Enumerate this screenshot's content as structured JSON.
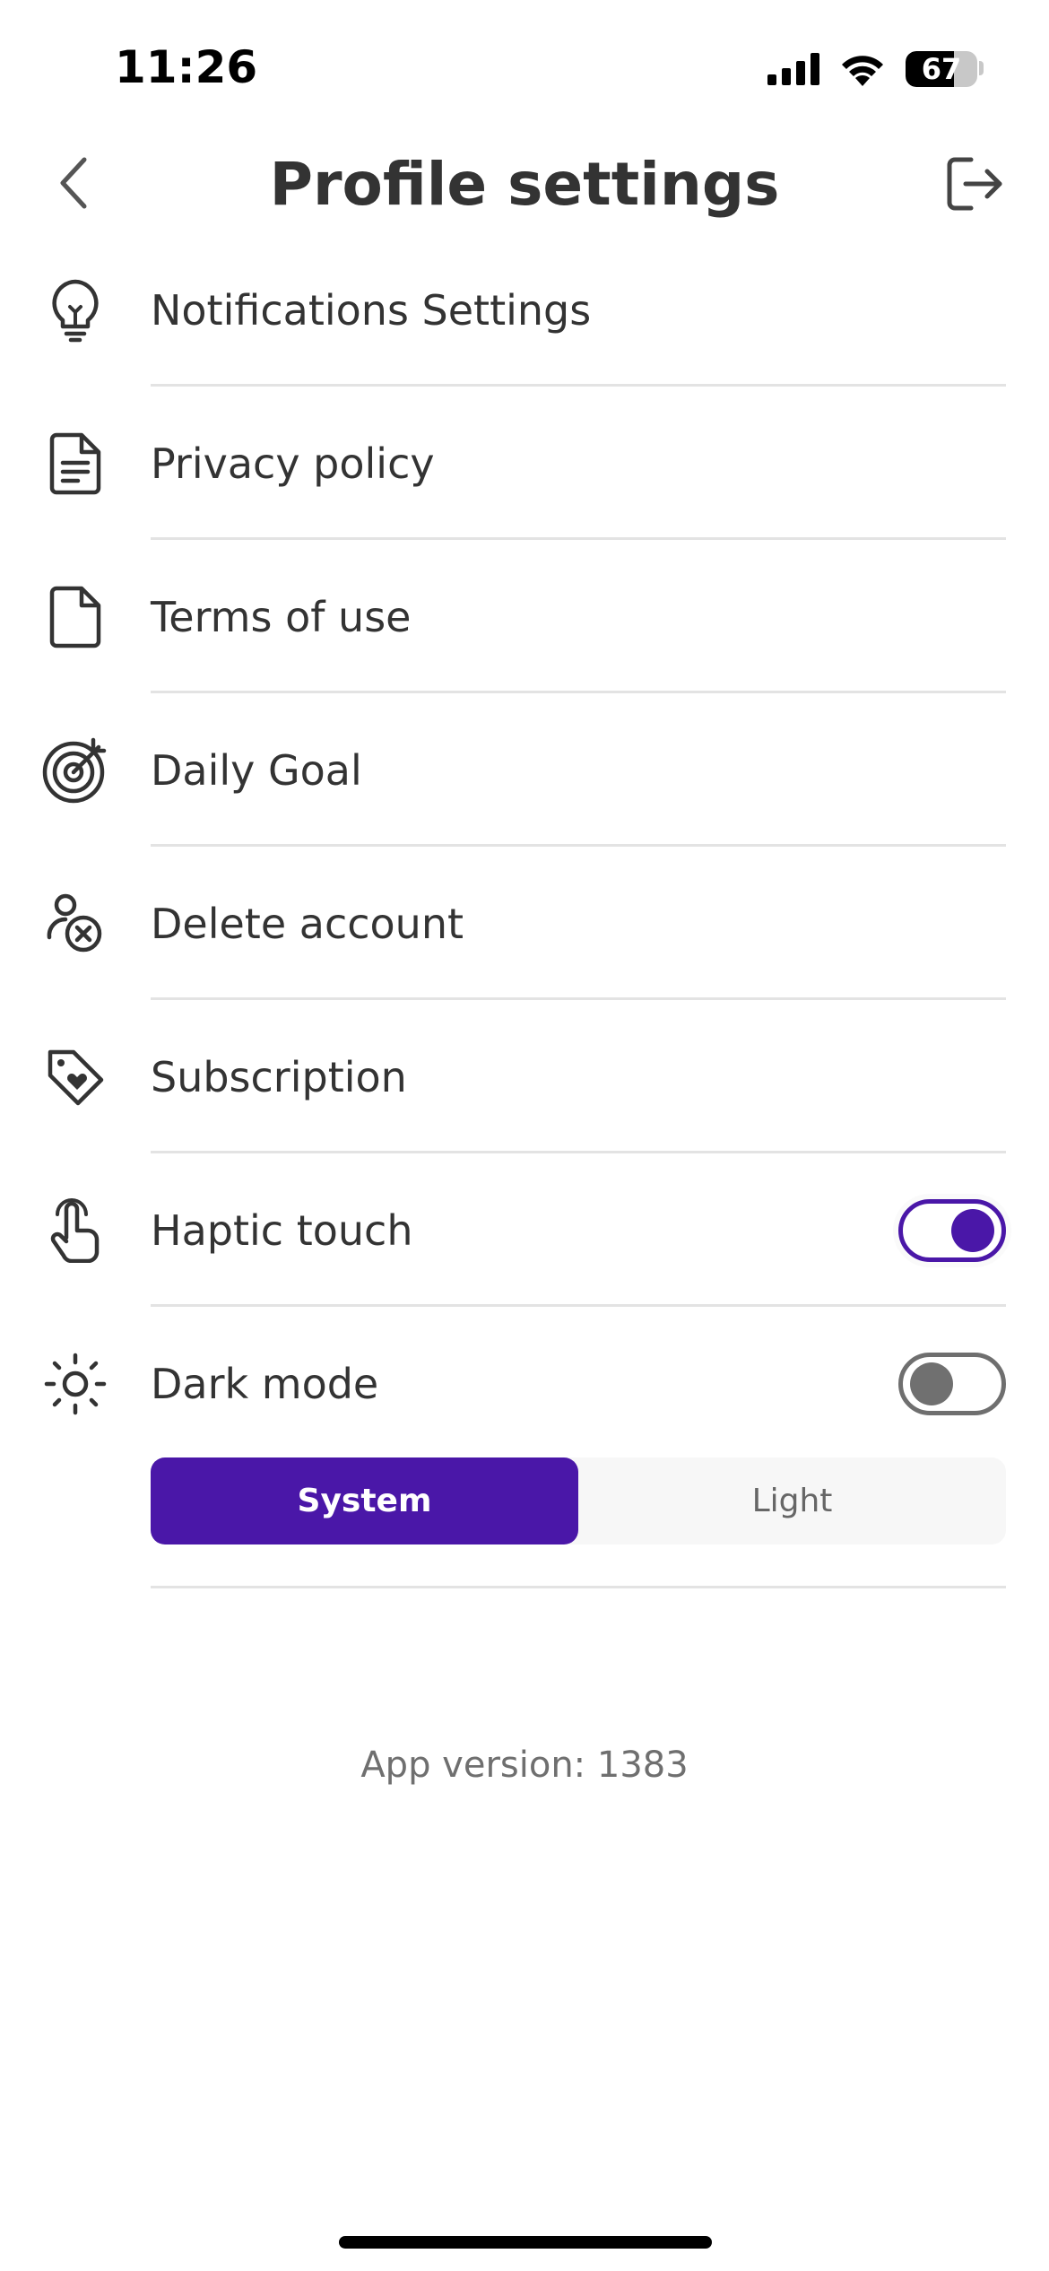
{
  "status_bar": {
    "time": "11:26",
    "battery_percent": 67,
    "battery_label": "67",
    "icons": [
      "cellular-signal-icon",
      "wifi-icon",
      "battery-icon"
    ]
  },
  "header": {
    "title": "Profile settings",
    "back_icon": "chevron-left-icon",
    "logout_icon": "logout-icon"
  },
  "settings": {
    "items": [
      {
        "label": "Notifications Settings",
        "icon": "lightbulb-icon"
      },
      {
        "label": "Privacy policy",
        "icon": "document-lines-icon"
      },
      {
        "label": "Terms of use",
        "icon": "document-icon"
      },
      {
        "label": "Daily Goal",
        "icon": "target-icon"
      },
      {
        "label": "Delete account",
        "icon": "user-remove-icon"
      },
      {
        "label": "Subscription",
        "icon": "tag-heart-icon"
      }
    ],
    "haptic": {
      "label": "Haptic touch",
      "icon": "touch-icon",
      "enabled": true
    },
    "dark_mode": {
      "label": "Dark mode",
      "icon": "sun-icon",
      "enabled": false,
      "options": [
        "System",
        "Light"
      ],
      "selected": "System"
    }
  },
  "footer": {
    "app_version": "App version: 1383"
  },
  "colors": {
    "accent": "#4a17a8",
    "text": "#333333",
    "muted": "#6f6f6f",
    "divider": "#e3e3e3"
  }
}
